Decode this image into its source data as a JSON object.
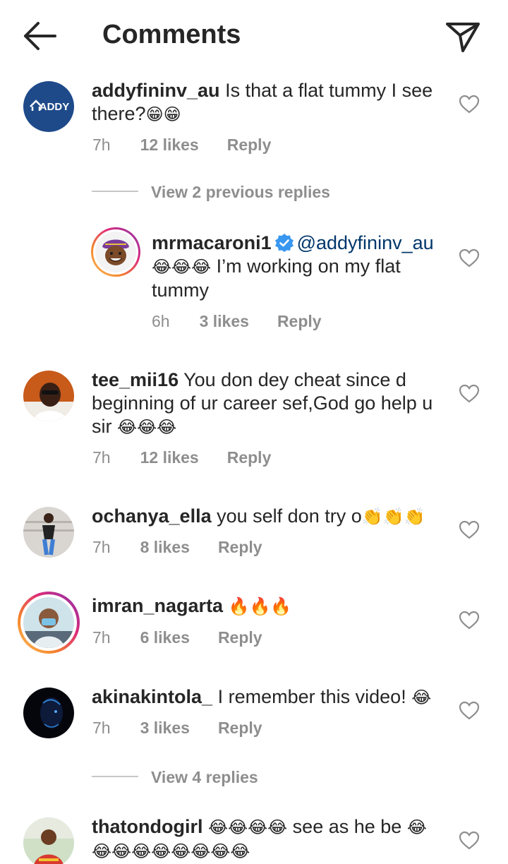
{
  "header": {
    "title": "Comments",
    "back_icon": "back-arrow-icon",
    "send_icon": "send-icon"
  },
  "emoji": {
    "laugh": "😂",
    "grin": "😁",
    "clap": "👏",
    "fire": "🔥"
  },
  "comments": [
    {
      "username": "addyfininv_au",
      "text": "Is that a flat tummy I see there?",
      "emoji_suffix": "😁😁",
      "time": "7h",
      "likes": "12 likes",
      "reply": "Reply",
      "avatar_text": "ADDY",
      "view_replies": "View 2 previous replies"
    },
    {
      "username": "mrmacaroni1",
      "verified": true,
      "mention": "@addyfininv_au",
      "emoji_prefix": "😂😂😂",
      "text": "I’m working on my flat tummy",
      "time": "6h",
      "likes": "3 likes",
      "reply": "Reply"
    },
    {
      "username": "tee_mii16",
      "text": "You don dey cheat since d beginning of ur career sef,God go help u sir",
      "emoji_suffix": "😂😂😂",
      "time": "7h",
      "likes": "12 likes",
      "reply": "Reply"
    },
    {
      "username": "ochanya_ella",
      "text": "you self don try o",
      "emoji_suffix": "👏👏👏",
      "time": "7h",
      "likes": "8 likes",
      "reply": "Reply"
    },
    {
      "username": "imran_nagarta",
      "text": "",
      "emoji_suffix": "🔥🔥🔥",
      "time": "7h",
      "likes": "6 likes",
      "reply": "Reply"
    },
    {
      "username": "akinakintola_",
      "text": "I remember this video!",
      "emoji_suffix": "😂",
      "time": "7h",
      "likes": "3 likes",
      "reply": "Reply",
      "view_replies": "View 4 replies"
    },
    {
      "username": "thatondogirl",
      "emoji_prefix": "😂😂😂😂",
      "text": "see as he be",
      "emoji_suffix": "😂😂😂😂😂😂😂😂😂"
    }
  ],
  "colors": {
    "text": "#262626",
    "muted": "#8e8e8e",
    "mention": "#00376b",
    "verified": "#3897f0"
  }
}
